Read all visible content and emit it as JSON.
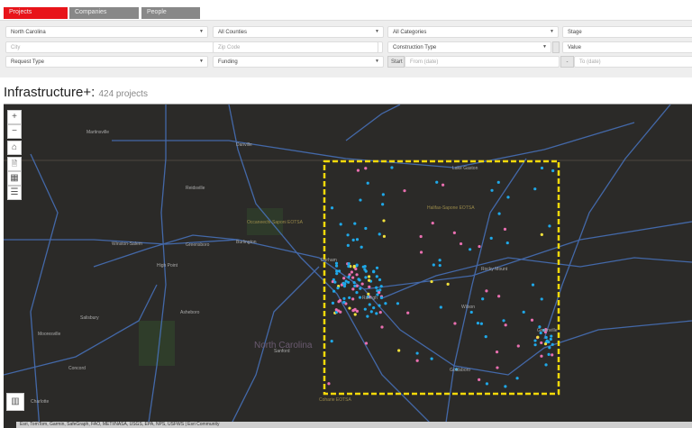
{
  "tabs": [
    {
      "label": "Projects",
      "active": true
    },
    {
      "label": "Companies"
    },
    {
      "label": "People"
    }
  ],
  "filters": {
    "state": "North Carolina",
    "counties": "All Counties",
    "categories": "All Categories",
    "stage": "Stage",
    "city_placeholder": "City",
    "zip_placeholder": "Zip Code",
    "construction_type": "Construction Type",
    "value": "Value",
    "request_type": "Request Type",
    "funding": "Funding",
    "start_label": "Start",
    "from_placeholder": "From (date)",
    "range_sep": "-",
    "to_placeholder": "To (date)"
  },
  "header": {
    "title": "Infrastructure+:",
    "count": "424 projects"
  },
  "map": {
    "tools": [
      {
        "name": "zoom-in",
        "glyph": "+"
      },
      {
        "name": "zoom-out",
        "glyph": "−"
      },
      {
        "name": "home",
        "glyph": "⌂"
      },
      {
        "name": "print",
        "glyph": "🗎"
      },
      {
        "name": "basemap",
        "glyph": "▦"
      },
      {
        "name": "legend",
        "glyph": "☰"
      }
    ],
    "chart_button": "▥",
    "places": [
      "Martinsville",
      "Danville",
      "Reidsville",
      "Winston-Salem",
      "Greensboro",
      "Burlington",
      "High Point",
      "Durham",
      "Raleigh",
      "Rocky Mount",
      "Wilson",
      "Greenville",
      "Goldsboro",
      "Sanford",
      "North Carolina",
      "Charlotte",
      "Concord",
      "Asheboro",
      "Salisbury",
      "Mooresville",
      "Lake Gaston",
      "Halifax-Sapone EOTSA",
      "Occaneechi-Saponi EOTSA",
      "Coharie EOTSA"
    ],
    "attribution": "Esri, TomTom, Garmin, SafeGraph, FAO, METI/NASA, USGS, EPA, NPS, USFWS | Esri Community",
    "colors": {
      "selection": "#f5d90a",
      "dot_blue": "#1fa8e8",
      "dot_pink": "#e96fb0",
      "dot_yellow": "#f2e13b",
      "road": "#4a78c8"
    }
  }
}
